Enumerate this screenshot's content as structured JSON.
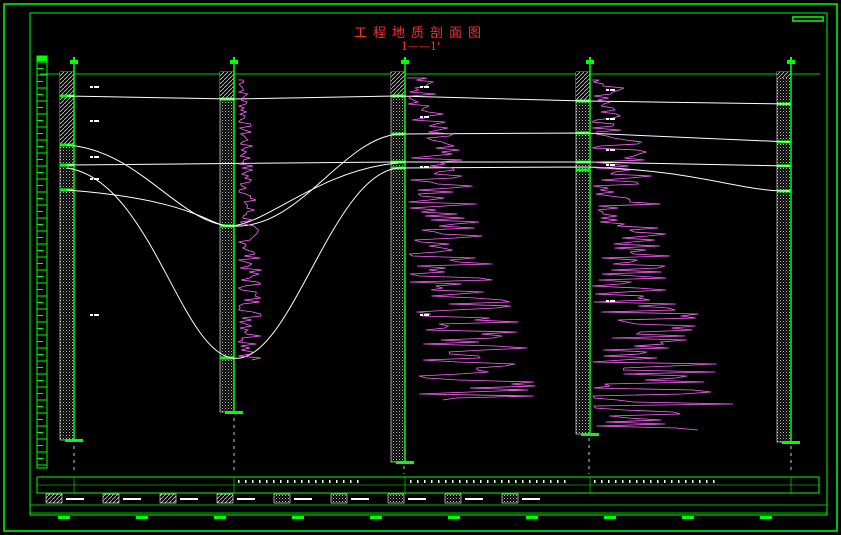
{
  "drawing": {
    "title": "工程地质剖面图",
    "section": "1——1'"
  },
  "colors": {
    "frame": "#00ff00",
    "boundary": "#ffffff",
    "log_curve": "#ff66ff",
    "title": "#ff2a2a"
  }
}
